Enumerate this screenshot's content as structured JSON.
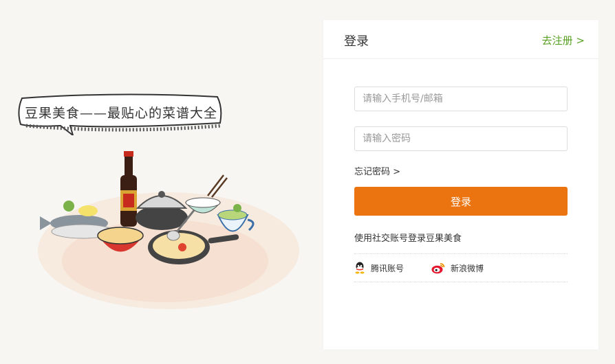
{
  "illustration": {
    "slogan": "豆果美食——最贴心的菜谱大全"
  },
  "login": {
    "title": "登录",
    "register_link": "去注册 >",
    "phone_placeholder": "请输入手机号/邮箱",
    "password_placeholder": "请输入密码",
    "forgot_link": "忘记密码 >",
    "submit_label": "登录",
    "social_title": "使用社交账号登录豆果美食",
    "social": [
      {
        "label": "腾讯账号",
        "icon": "qq-icon"
      },
      {
        "label": "新浪微博",
        "icon": "weibo-icon"
      }
    ]
  },
  "colors": {
    "accent_orange": "#eb7410",
    "link_green": "#59a022",
    "background": "#f7f6f3"
  }
}
